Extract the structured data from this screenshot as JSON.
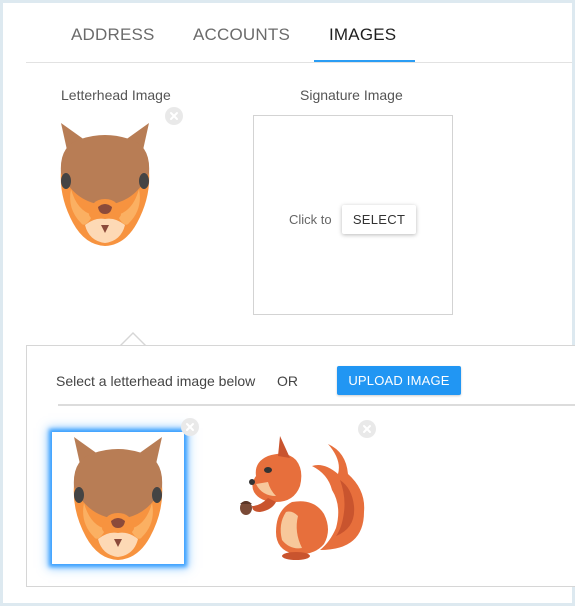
{
  "tabs": [
    {
      "label": "ADDRESS",
      "active": false
    },
    {
      "label": "ACCOUNTS",
      "active": false
    },
    {
      "label": "IMAGES",
      "active": true
    }
  ],
  "letterhead": {
    "label": "Letterhead Image",
    "image_icon": "squirrel-face-icon"
  },
  "signature": {
    "label": "Signature Image",
    "click_to": "Click to",
    "select_label": "SELECT"
  },
  "picker": {
    "instruction": "Select a letterhead image below",
    "or_text": "OR",
    "upload_label": "UPLOAD IMAGE",
    "images": [
      {
        "icon": "squirrel-face-icon",
        "selected": true
      },
      {
        "icon": "squirrel-icon",
        "selected": false
      }
    ]
  },
  "colors": {
    "accent": "#2196f3",
    "selection_glow": "#3aa0ff",
    "fur_orange": "#f7933f",
    "fur_brown": "#b87d55"
  }
}
